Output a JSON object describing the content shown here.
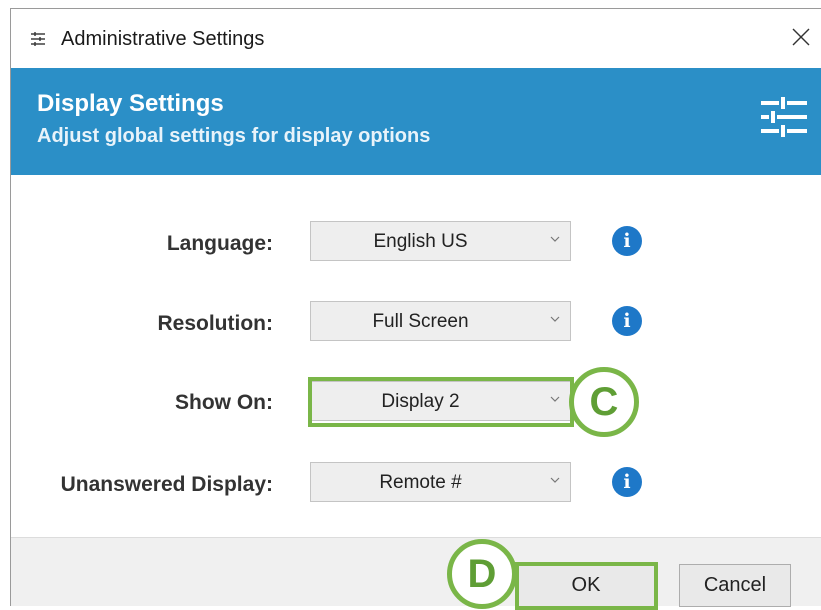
{
  "window": {
    "title": "Administrative Settings",
    "close_glyph": "✕"
  },
  "header": {
    "title": "Display Settings",
    "subtitle": "Adjust global settings for display options",
    "icon": "sliders-icon",
    "bg_color": "#2b8fc7"
  },
  "fields": [
    {
      "label": "Language:",
      "value": "English US",
      "has_info": true
    },
    {
      "label": "Resolution:",
      "value": "Full Screen",
      "has_info": true
    },
    {
      "label": "Show On:",
      "value": "Display 2",
      "has_info": false
    },
    {
      "label": "Unanswered Display:",
      "value": "Remote #",
      "has_info": true
    }
  ],
  "info_glyph": "i",
  "callouts": {
    "c": "C",
    "d": "D",
    "color": "#7ab648"
  },
  "buttons": {
    "ok": "OK",
    "cancel": "Cancel"
  }
}
